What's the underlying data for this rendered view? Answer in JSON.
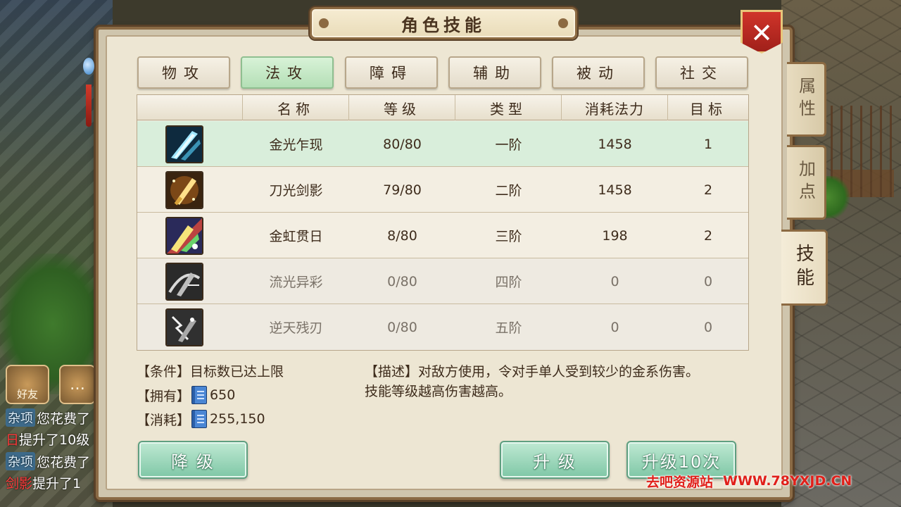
{
  "title": "角色技能",
  "close_symbol": "✕",
  "category_tabs": [
    {
      "label": "物攻",
      "active": false
    },
    {
      "label": "法攻",
      "active": true
    },
    {
      "label": "障碍",
      "active": false
    },
    {
      "label": "辅助",
      "active": false
    },
    {
      "label": "被动",
      "active": false
    },
    {
      "label": "社交",
      "active": false
    }
  ],
  "side_tabs": [
    {
      "label": "属性",
      "active": false
    },
    {
      "label": "加点",
      "active": false
    },
    {
      "label": "技能",
      "active": true
    }
  ],
  "table": {
    "headers": [
      "",
      "名称",
      "等级",
      "类型",
      "消耗法力",
      "目标"
    ],
    "rows": [
      {
        "icon": "blade-blue-icon",
        "name": "金光乍现",
        "level": "80/80",
        "type": "一阶",
        "mana": "1458",
        "target": "1",
        "selected": true,
        "locked": false
      },
      {
        "icon": "blade-gold-icon",
        "name": "刀光剑影",
        "level": "79/80",
        "type": "二阶",
        "mana": "1458",
        "target": "2",
        "selected": false,
        "locked": false
      },
      {
        "icon": "blade-rainbow-icon",
        "name": "金虹贯日",
        "level": "8/80",
        "type": "三阶",
        "mana": "198",
        "target": "2",
        "selected": false,
        "locked": false
      },
      {
        "icon": "blade-gray-icon",
        "name": "流光异彩",
        "level": "0/80",
        "type": "四阶",
        "mana": "0",
        "target": "0",
        "selected": false,
        "locked": true
      },
      {
        "icon": "blade-lightning-icon",
        "name": "逆天残刃",
        "level": "0/80",
        "type": "五阶",
        "mana": "0",
        "target": "0",
        "selected": false,
        "locked": true
      }
    ]
  },
  "info": {
    "condition_label": "【条件】",
    "condition_value": "目标数已达上限",
    "own_label": "【拥有】",
    "own_value": "650",
    "cost_label": "【消耗】",
    "cost_value": "255,150",
    "desc_label": "【描述】",
    "desc_line1": "对敌方使用，令对手单人受到较少的金系伤害。",
    "desc_line2": "技能等级越高伤害越高。"
  },
  "buttons": {
    "downgrade": "降  级",
    "upgrade": "升   级",
    "upgrade10": "升级10次"
  },
  "chat": {
    "friend_label": "好友",
    "msg_symbol": "…",
    "lines": [
      {
        "tag": "杂项",
        "text": "您花费了"
      },
      {
        "tag": "",
        "red": "日",
        "text": "提升了10级"
      },
      {
        "tag": "杂项",
        "text": "您花费了"
      },
      {
        "tag": "",
        "red": "剑影",
        "text": "提升了1"
      }
    ]
  },
  "watermark": {
    "left": "去吧资源站",
    "right": "WWW.78YXJD.CN"
  },
  "colors": {
    "accent_green": "#b4dfb6",
    "panel_bg": "#ede6d3",
    "close_red": "#c0281f",
    "watermark_red": "#e0201a"
  }
}
